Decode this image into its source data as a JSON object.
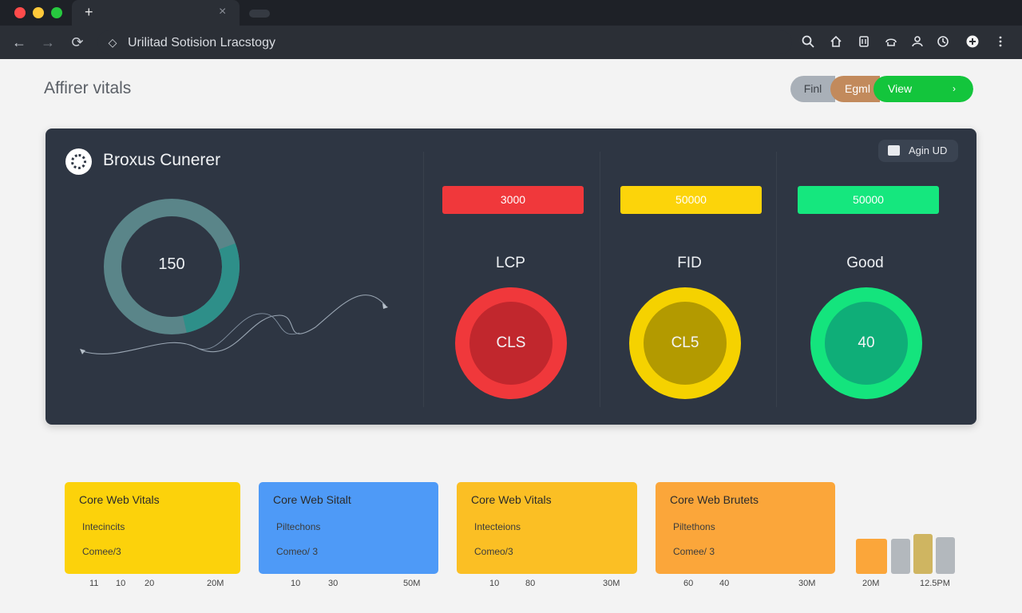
{
  "browser": {
    "url": "Urilitad Sotision Lracstogy",
    "tab_plus": "+",
    "tab_close": "×",
    "nav": {
      "back": "←",
      "forward": "→",
      "reload": "⟳"
    },
    "toolbar_icons": [
      "search-icon",
      "home-icon",
      "bookmark-icon",
      "share-icon",
      "profile-icon",
      "history-icon",
      "extension-icon",
      "menu-icon"
    ]
  },
  "page": {
    "title": "Affirer vitals",
    "segments": [
      "Finl",
      "Egml",
      "View"
    ],
    "segment_arrow": "›"
  },
  "panel": {
    "title": "Broxus Cunerer",
    "button": "Agin UD",
    "donut": {
      "value": "150",
      "fraction": 0.27,
      "color_track": "#5a8589",
      "color_fill": "#2e8f89"
    },
    "metrics": [
      {
        "bar_value": "3000",
        "label": "LCP",
        "circle_value": "CLS",
        "bar_color": "#f0383b",
        "ring_color": "#f0383b",
        "inner_color": "#c1272d"
      },
      {
        "bar_value": "50000",
        "label": "FID",
        "circle_value": "CL5",
        "bar_color": "#fcd40a",
        "ring_color": "#f5d200",
        "inner_color": "#b39a00"
      },
      {
        "bar_value": "50000",
        "label": "Good",
        "circle_value": "40",
        "bar_color": "#15e77e",
        "ring_color": "#14e47d",
        "inner_color": "#0fae78"
      }
    ]
  },
  "cards": [
    {
      "title": "Core Web Vitals",
      "subtitle": "Intecincits",
      "meta": "Comee/3",
      "color": "#fcd20b",
      "ticks": [
        "11",
        "10",
        "20",
        "20M"
      ]
    },
    {
      "title": "Core Web Sitalt",
      "subtitle": "Piltechons",
      "meta": "Comeo/ 3",
      "color": "#4e9af7",
      "ticks": [
        "10",
        "30",
        "50M"
      ]
    },
    {
      "title": "Core Web Vitals",
      "subtitle": "Intecteions",
      "meta": "Comeo/3",
      "color": "#fbbf24",
      "ticks": [
        "10",
        "80",
        "30M"
      ]
    },
    {
      "title": "Core Web Brutets",
      "subtitle": "Piltethons",
      "meta": "Comee/ 3",
      "color": "#fba63a",
      "ticks": [
        "60",
        "40",
        "30M"
      ]
    }
  ],
  "mini_chart": {
    "ticks": [
      "20M",
      "12.5PM"
    ],
    "bars": [
      {
        "value": 42,
        "color": "#fba63a"
      },
      {
        "value": 42,
        "color": "#b3b8bd"
      },
      {
        "value": 48,
        "color": "#cfb561"
      },
      {
        "value": 44,
        "color": "#b3b8bd"
      }
    ]
  }
}
